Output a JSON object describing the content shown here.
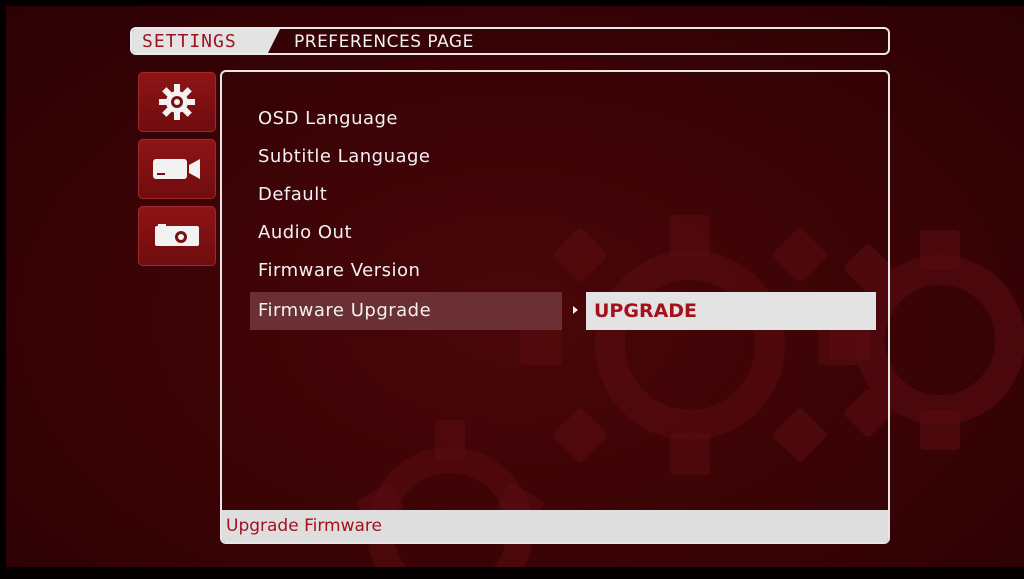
{
  "header": {
    "section": "SETTINGS",
    "page": "PREFERENCES PAGE"
  },
  "side_icons": [
    {
      "icon": "gear-icon",
      "selected": true
    },
    {
      "icon": "video-camera-icon",
      "selected": false
    },
    {
      "icon": "photo-camera-icon",
      "selected": false
    }
  ],
  "menu": {
    "items": [
      {
        "label": "OSD Language"
      },
      {
        "label": "Subtitle Language"
      },
      {
        "label": "Default"
      },
      {
        "label": "Audio Out"
      },
      {
        "label": "Firmware Version"
      },
      {
        "label": "Firmware Upgrade"
      }
    ],
    "selected_index": 5
  },
  "submenu": {
    "value": "UPGRADE"
  },
  "status": {
    "text": "Upgrade Firmware"
  },
  "colors": {
    "background": "#3a0306",
    "accent_text": "#a5101d",
    "highlight": "#6a3034",
    "panel_border": "#e6e6e6"
  }
}
